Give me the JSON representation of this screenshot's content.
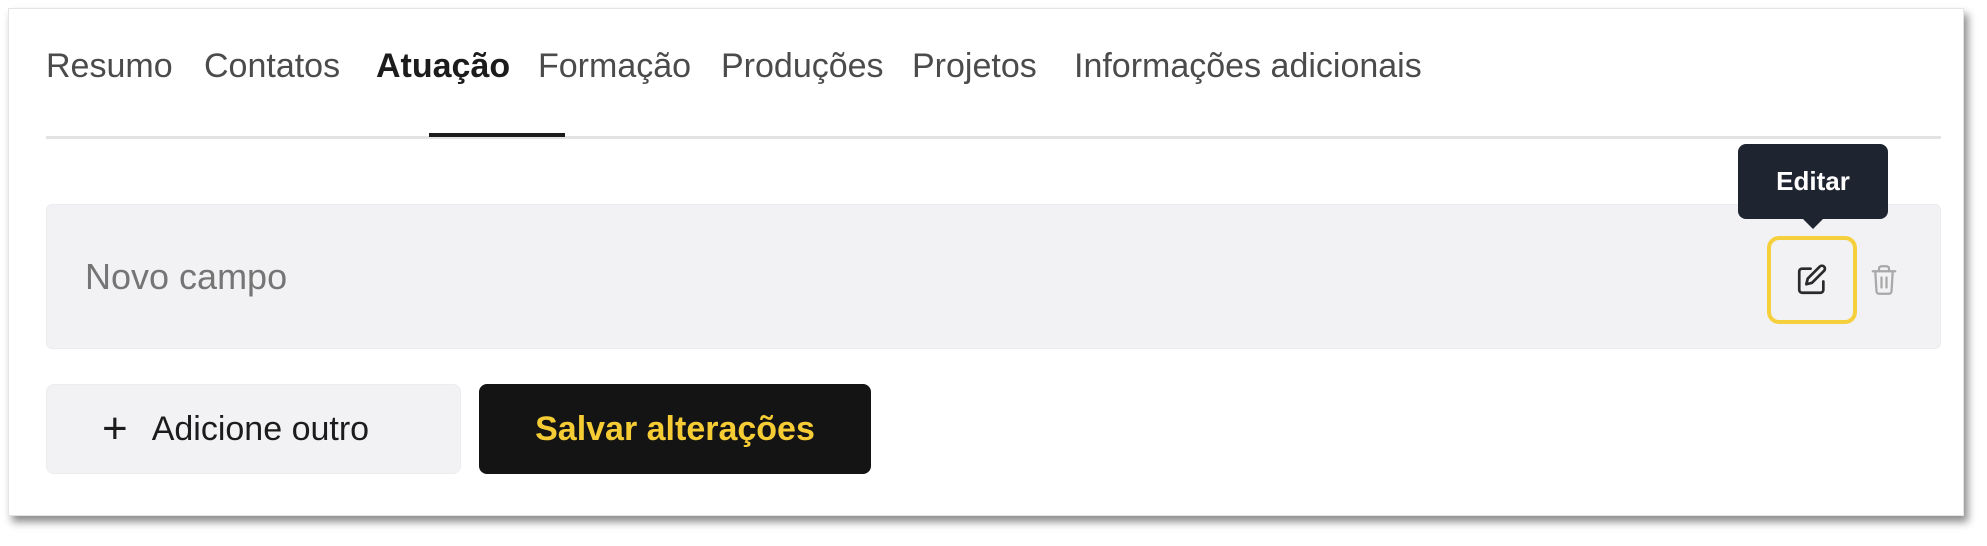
{
  "tabs": [
    {
      "label": "Resumo"
    },
    {
      "label": "Contatos"
    },
    {
      "label": "Atuação",
      "active": true
    },
    {
      "label": "Formação"
    },
    {
      "label": "Produções"
    },
    {
      "label": "Projetos"
    },
    {
      "label": "Informações adicionais"
    }
  ],
  "field": {
    "placeholder": "Novo campo",
    "value": ""
  },
  "tooltip": {
    "text": "Editar"
  },
  "actions": {
    "add_label": "Adicione outro",
    "add_icon": "+",
    "save_label": "Salvar alterações"
  },
  "colors": {
    "accent_yellow": "#f6cc35",
    "highlight_border": "#f6cf3c",
    "dark": "#141414",
    "tooltip_bg": "#1f2431",
    "field_bg": "#f2f2f4"
  },
  "icons": {
    "edit": "pencil-square-icon",
    "delete": "trash-icon",
    "add": "plus-icon"
  }
}
